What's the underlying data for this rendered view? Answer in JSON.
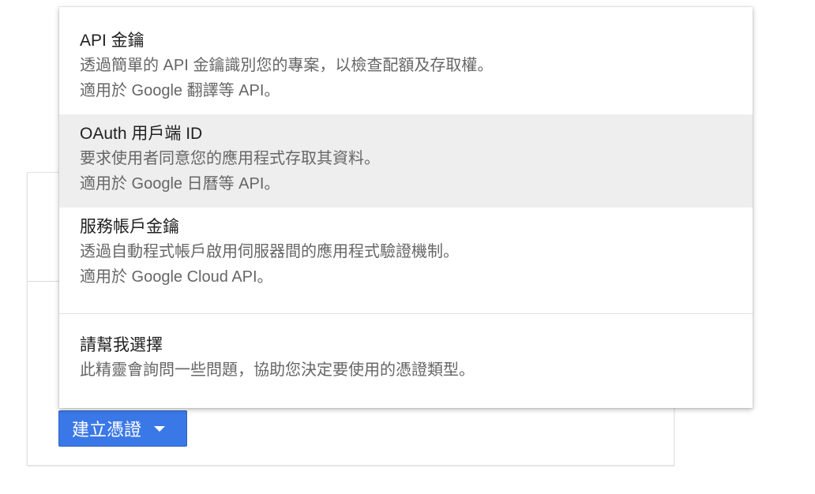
{
  "create_button": {
    "label": "建立憑證",
    "icon": "caret-down-icon"
  },
  "menu": {
    "items": [
      {
        "title": "API 金鑰",
        "description": "透過簡單的 API 金鑰識別您的專案，以檢查配額及存取權。",
        "usage": "適用於 Google 翻譯等 API。"
      },
      {
        "title": "OAuth 用戶端 ID",
        "description": "要求使用者同意您的應用程式存取其資料。",
        "usage": "適用於 Google 日曆等 API。"
      },
      {
        "title": "服務帳戶金鑰",
        "description": "透過自動程式帳戶啟用伺服器間的應用程式驗證機制。",
        "usage": "適用於 Google Cloud API。"
      },
      {
        "title": "請幫我選擇",
        "description": "此精靈會詢問一些問題，協助您決定要使用的憑證類型。"
      }
    ]
  },
  "colors": {
    "button_primary": "#3b78e7",
    "hover_background": "#eeeeee",
    "title_text": "#212121",
    "description_text": "#666666"
  }
}
